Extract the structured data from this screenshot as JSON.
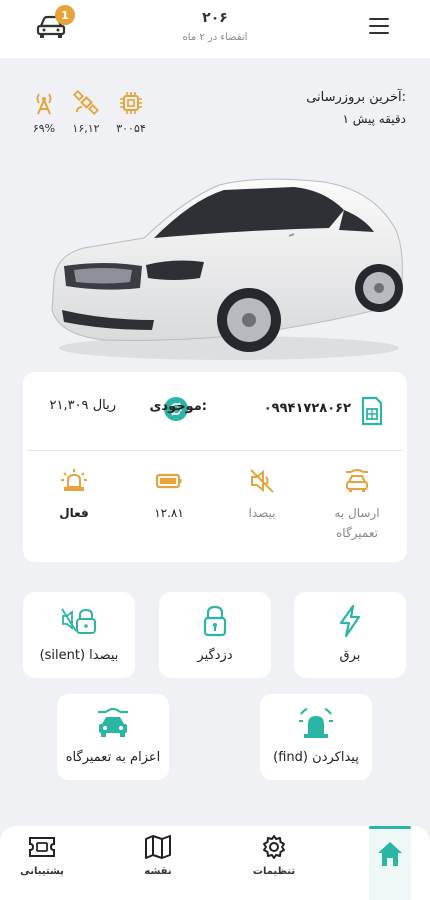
{
  "header": {
    "title": "۲۰۶",
    "subtitle": "انقضاء در ۲ ماه",
    "notification_count": "1"
  },
  "stats": [
    {
      "icon": "chip-icon",
      "value": "۳۰۰۵۴"
    },
    {
      "icon": "satellite-icon",
      "value": "۱۶,۱۲"
    },
    {
      "icon": "antenna-icon",
      "value": "۶۹%"
    }
  ],
  "last_update": {
    "title": "آخرین بروزرسانی:",
    "time": "۱ دقیقه پیش"
  },
  "sim": {
    "number": "۰۹۹۴۱۷۲۸۰۶۲",
    "balance_label": "موجودی:",
    "balance_value": "۲۱,۳۰۹ ریال"
  },
  "status_items": [
    {
      "icon": "repair-car-icon",
      "label": "ارسال به تعمیرگاه",
      "color": "#e8a33a",
      "active": false
    },
    {
      "icon": "mute-icon",
      "label": "بیصدا",
      "color": "#e8a33a",
      "active": false
    },
    {
      "icon": "battery-icon",
      "label": "۱۲.۸۱",
      "color": "#e8a33a",
      "active": true
    },
    {
      "icon": "siren-icon",
      "label": "فعال",
      "color": "#e8a33a",
      "active": true
    }
  ],
  "actions": {
    "power": "برق",
    "alarm": "دزدگیر",
    "silent": "(silent) بیصدا",
    "find": "(find) پیداکردن",
    "repair": "اعزام به تعمیرگاه"
  },
  "nav": {
    "home": "",
    "settings": "تنظیمات",
    "map": "نقشه",
    "support": "پشتیبانی"
  },
  "colors": {
    "accent": "#2bb5a5",
    "warning": "#e8a33a"
  }
}
